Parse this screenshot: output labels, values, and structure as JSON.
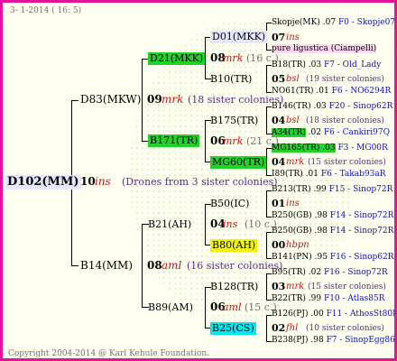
{
  "header": {
    "date": "3-  1-2014 ( 16:  5)"
  },
  "root": {
    "name": "D102(MM)",
    "year": "10",
    "breeder": "ins",
    "drones": "(Drones from 3 sister colonies)"
  },
  "g1": {
    "top": {
      "name": "D83(MKW)",
      "year": "09",
      "breeder": "mrk",
      "info": "(18 sister colonies)"
    },
    "bottom": {
      "name": "B14(MM)",
      "year": "08",
      "breeder": "aml",
      "info": "(16 sister colonies)"
    }
  },
  "g2": {
    "a": {
      "name": "D21(MKK)",
      "year": "08",
      "breeder": "mrk",
      "info": "(16 c.)"
    },
    "b": {
      "name": "B171(TR)",
      "year": "06",
      "breeder": "mrk",
      "info": "(21 c.)"
    },
    "c": {
      "name": "B21(AH)",
      "year": "04",
      "breeder": "ins",
      "info": "(10 c.)"
    },
    "d": {
      "name": "B89(AM)",
      "year": "06",
      "breeder": "aml",
      "info": "(15 c.)"
    }
  },
  "g3": [
    {
      "name": "D01(MKK)"
    },
    {
      "name": "B10(TR)"
    },
    {
      "name": "B175(TR)"
    },
    {
      "name": "MG60(TR)"
    },
    {
      "name": "B50(IC)"
    },
    {
      "name": "B80(AH)"
    },
    {
      "name": "B128(TR)"
    },
    {
      "name": "B25(CS)"
    }
  ],
  "g3p": [
    {
      "year": "07",
      "breeder": "ins",
      "info": ""
    },
    {
      "year": "05",
      "breeder": "bsl",
      "info": "(19 sister colonies)"
    },
    {
      "year": "04",
      "breeder": "bsl",
      "info": "(18 sister colonies)"
    },
    {
      "year": "04",
      "breeder": "mrk",
      "info": "(15 sister colonies)"
    },
    {
      "year": "01",
      "breeder": "ins",
      "info": ""
    },
    {
      "year": "00",
      "breeder": "hbpn",
      "info": ""
    },
    {
      "year": "03",
      "breeder": "mrk",
      "info": "(15 sister colonies)"
    },
    {
      "year": "02",
      "breeder": "fhl",
      "info": "(10 sister colonies)"
    }
  ],
  "g4": [
    {
      "name": "Skopje(MK) .07",
      "year": "",
      "code": "F0 - Skopje07Q"
    },
    {
      "name": "pure ligustica (Ciampelli)",
      "year": "",
      "code": "more"
    },
    {
      "name": "B18(TR)",
      "year": ".03",
      "code": "F7 - Old_Lady"
    },
    {
      "name": "NO61(TR)",
      "year": ".01",
      "code": "F6 - NO6294R"
    },
    {
      "name": "B146(TR)",
      "year": ".03",
      "code": "F20 - Sinop62R"
    },
    {
      "name": "A34(TR)",
      "year": ".02",
      "code": "F6 - Cankiri97Q"
    },
    {
      "name": "MG165(TR) .03",
      "year": "",
      "code": "F3 - MG00R"
    },
    {
      "name": "I89(TR)",
      "year": ".01",
      "code": "F6 - Takab93aR"
    },
    {
      "name": "B213(TR)",
      "year": ".99",
      "code": "F15 - Sinop72R"
    },
    {
      "name": "B250(GB)",
      "year": ".98",
      "code": "F14 - Sinop72R"
    },
    {
      "name": "B250(GB)",
      "year": ".98",
      "code": "F14 - Sinop72R"
    },
    {
      "name": "B141(PN)",
      "year": ".95",
      "code": "F16 - Sinop62R"
    },
    {
      "name": "B95(TR)",
      "year": ".02",
      "code": "F16 - Sinop72R"
    },
    {
      "name": "B22(TR)",
      "year": ".99",
      "code": "F10 - Atlas85R"
    },
    {
      "name": "B126(PJ)",
      "year": ".00",
      "code": "F11 - AthosSt80R"
    },
    {
      "name": "B238(PJ)",
      "year": ".98",
      "code": "F7 - SinopEgg86R"
    }
  ],
  "footer": {
    "copyright": "Copyright 2004-2014 @ Karl Kehule Foundation."
  }
}
